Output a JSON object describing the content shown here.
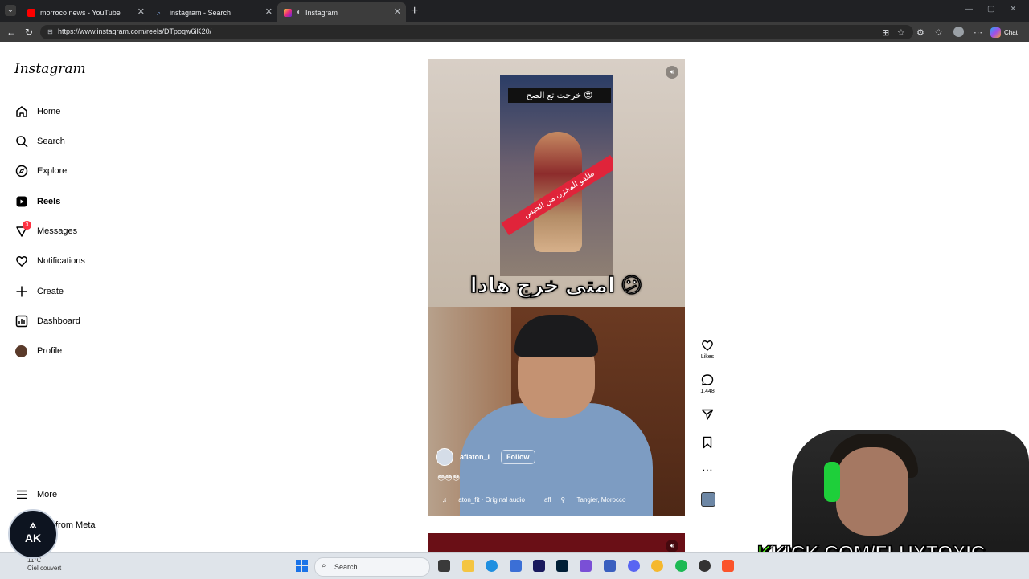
{
  "browser": {
    "tabs": [
      {
        "label": "morroco news - YouTube",
        "icon": "youtube-icon",
        "color": "#ff0000"
      },
      {
        "label": "instagram - Search",
        "icon": "search-icon",
        "color": "#4285f4"
      },
      {
        "label": "Instagram",
        "icon": "instagram-icon",
        "color": "#e1306c",
        "active": true
      }
    ],
    "url": "https://www.instagram.com/reels/DTpoqw6iK20/",
    "chat_label": "Chat"
  },
  "instagram": {
    "logo": "Instagram",
    "nav": [
      {
        "label": "Home",
        "icon": "home-icon"
      },
      {
        "label": "Search",
        "icon": "search-icon"
      },
      {
        "label": "Explore",
        "icon": "compass-icon"
      },
      {
        "label": "Reels",
        "icon": "reels-icon",
        "active": true
      },
      {
        "label": "Messages",
        "icon": "messenger-icon",
        "badge": "3"
      },
      {
        "label": "Notifications",
        "icon": "heart-icon"
      },
      {
        "label": "Create",
        "icon": "plus-icon"
      },
      {
        "label": "Dashboard",
        "icon": "dashboard-icon"
      },
      {
        "label": "Profile",
        "icon": "avatar"
      }
    ],
    "more_label": "More",
    "from_meta_label": "from Meta"
  },
  "reel": {
    "clip_caption": "خرجت تع الصح 😍",
    "banner_text": "طلقو المخزن من الحبس",
    "main_caption": "امتى خرج هادا 😕",
    "author": "aflaton_i",
    "follow_label": "Follow",
    "emojis": "😳😳😳",
    "audio": "aton_fit · Original audio",
    "audio_extra": "afl",
    "location": "Tangier, Morocco"
  },
  "actions": {
    "likes_label": "Likes",
    "comments_count": "1,448"
  },
  "overlay": {
    "kick_prefix": "K",
    "kick_text": "KICK.COM/FLUXTOXIC",
    "logo_text": "AK"
  },
  "taskbar": {
    "weather_temp": "11°C",
    "weather_desc": "Ciel couvert",
    "search_placeholder": "Search"
  }
}
